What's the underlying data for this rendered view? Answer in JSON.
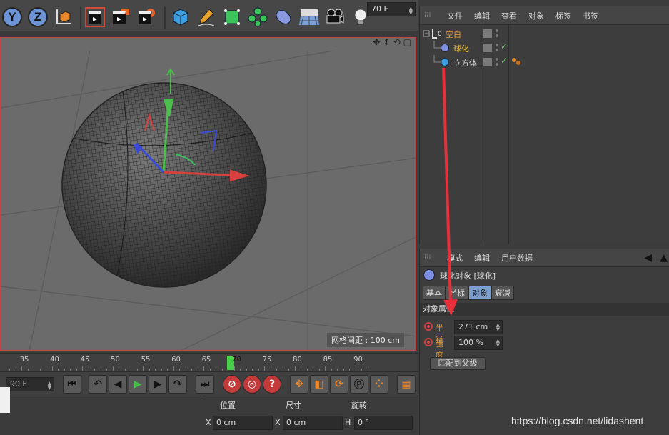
{
  "toolbar": {
    "axis_y": "Y",
    "axis_z": "Z",
    "icons": [
      "world-coordinates-icon",
      "render-view-icon",
      "render-picture-queue-icon",
      "render-settings-icon",
      "cube-object-icon",
      "pen-spline-icon",
      "subdivision-icon",
      "cloner-icon",
      "deformer-icon",
      "floor-scene-icon",
      "camera-icon",
      "light-bulb-icon"
    ]
  },
  "viewport": {
    "grid_label": "网格间距 : 100 cm",
    "nav_icons": [
      "move-view-icon",
      "pan-view-icon",
      "rotate-view-icon",
      "maximize-view-icon"
    ]
  },
  "timeline": {
    "ticks": [
      "35",
      "40",
      "45",
      "50",
      "55",
      "60",
      "65",
      "70",
      "75",
      "80",
      "85",
      "90"
    ],
    "current_frame": "70",
    "end_field": "70 F"
  },
  "transport": {
    "start_field": "90 F"
  },
  "coords": {
    "headers": [
      "位置",
      "尺寸",
      "旋转"
    ],
    "axes": [
      "X",
      "X",
      "H"
    ],
    "values": [
      "0 cm",
      "0 cm",
      "0 °"
    ]
  },
  "object_manager": {
    "menu": [
      "文件",
      "编辑",
      "查看",
      "对象",
      "标签",
      "书签"
    ],
    "objects": [
      {
        "name": "空白",
        "color": "#e09a3a"
      },
      {
        "name": "球化",
        "color": "#e8c040"
      },
      {
        "name": "立方体",
        "color": "#d8d8d8"
      }
    ]
  },
  "attribute_manager": {
    "menu": [
      "模式",
      "编辑",
      "用户数据"
    ],
    "title": "球化对象 [球化]",
    "tabs": [
      "基本",
      "坐标",
      "对象",
      "衰减"
    ],
    "active_tab": "对象",
    "section": "对象属性",
    "params": [
      {
        "label": "半径",
        "value": "271 cm"
      },
      {
        "label": "强度",
        "value": "100 %"
      }
    ],
    "button": "匹配到父级"
  },
  "watermark": "https://blog.csdn.net/lidashent"
}
